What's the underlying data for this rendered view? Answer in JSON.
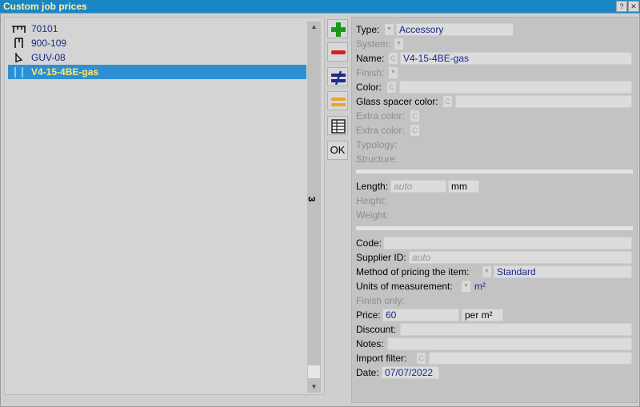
{
  "window": {
    "title": "Custom job prices",
    "help_label": "?",
    "close_label": "✕"
  },
  "tree": {
    "items": [
      {
        "label": "70101",
        "icon": "profile-icon"
      },
      {
        "label": "900-109",
        "icon": "profile-icon"
      },
      {
        "label": "GUV-08",
        "icon": "profile-icon"
      },
      {
        "label": "V4-15-4BE-gas",
        "icon": "spacer-icon",
        "selected": true
      }
    ],
    "count": "3"
  },
  "toolbar": {
    "add_icon": "plus-icon",
    "remove_icon": "minus-icon",
    "not_equal_icon": "not-equal-icon",
    "equal_icon": "equal-icon",
    "table_icon": "table-icon",
    "ok_label": "OK"
  },
  "form": {
    "type_label": "Type:",
    "type_value": "Accessory",
    "system_label": "System:",
    "name_label": "Name:",
    "name_value": "V4-15-4BE-gas",
    "finish_label": "Finish:",
    "color_label": "Color:",
    "glass_spacer_color_label": "Glass spacer color:",
    "extra_color1_label": "Extra color:",
    "extra_color2_label": "Extra color:",
    "typology_label": "Typology:",
    "structure_label": "Structure:",
    "length_label": "Length:",
    "length_placeholder": "auto",
    "length_unit": "mm",
    "height_label": "Height:",
    "weight_label": "Weight:",
    "code_label": "Code:",
    "supplier_id_label": "Supplier ID:",
    "supplier_id_placeholder": "auto",
    "pricing_method_label": "Method of pricing the item:",
    "pricing_method_value": "Standard",
    "units_label": "Units of measurement:",
    "units_value": "m²",
    "finish_only_label": "Finish only:",
    "price_label": "Price:",
    "price_value": "60",
    "price_unit": "per m²",
    "discount_label": "Discount:",
    "notes_label": "Notes:",
    "import_filter_label": "Import filter:",
    "date_label": "Date:",
    "date_value": "07/07/2022",
    "c_button": "C"
  },
  "colors": {
    "titlebar": "#1b86c4",
    "title_text": "#fff1a8",
    "selection": "#2f8fd3",
    "selection_text": "#ffe86a",
    "value_text": "#1a2a88"
  }
}
